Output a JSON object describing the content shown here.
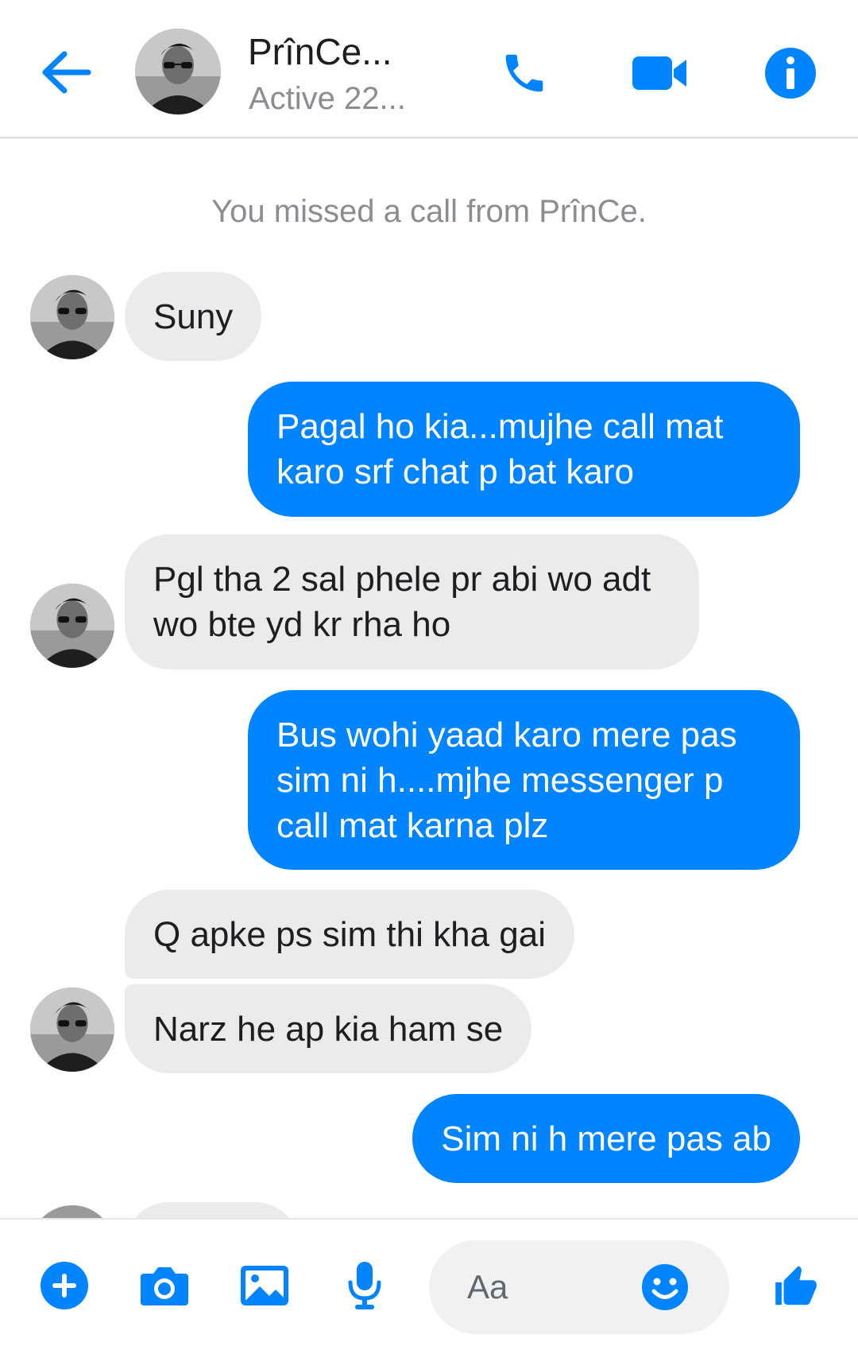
{
  "header": {
    "contact_name": "PrînCe...",
    "status": "Active 22...",
    "icons": {
      "back": "back-arrow-icon",
      "call": "phone-icon",
      "video": "video-camera-icon",
      "info": "info-icon"
    }
  },
  "thread": {
    "system_note": "You missed a call from PrînCe.",
    "messages": [
      {
        "sender": "contact",
        "text": "Suny"
      },
      {
        "sender": "me",
        "text": "Pagal ho kia...mujhe call mat karo srf chat p bat karo"
      },
      {
        "sender": "contact",
        "text": "Pgl tha 2 sal phele pr abi wo adt wo bte yd kr rha ho"
      },
      {
        "sender": "me",
        "text": "Bus wohi yaad karo mere pas sim ni h....mjhe messenger p call mat karna plz"
      },
      {
        "sender": "contact",
        "text": "Q apke ps sim thi kha gai"
      },
      {
        "sender": "contact",
        "text": "Narz he ap kia ham se"
      },
      {
        "sender": "me",
        "text": "Sim ni h mere pas ab"
      }
    ]
  },
  "composer": {
    "placeholder": "Aa",
    "icons": {
      "more": "plus-icon",
      "camera": "camera-icon",
      "gallery": "image-icon",
      "voice": "microphone-icon",
      "emoji": "smiley-icon",
      "like": "thumbs-up-icon"
    }
  },
  "colors": {
    "accent": "#0084ff",
    "incoming_bubble": "#ebebeb",
    "muted_text": "#8a8d91"
  }
}
